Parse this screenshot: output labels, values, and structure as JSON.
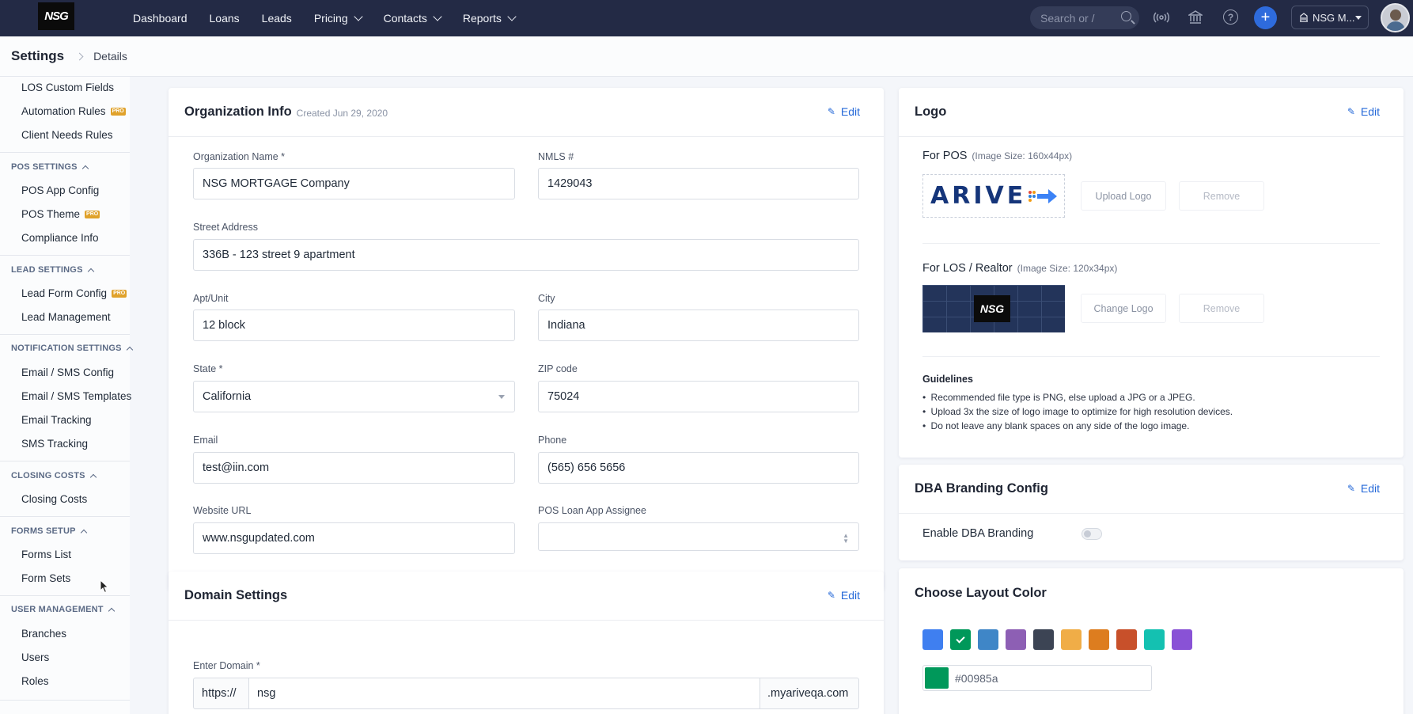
{
  "nav": {
    "logo_text": "NSG",
    "links": [
      {
        "label": "Dashboard",
        "has_menu": false
      },
      {
        "label": "Loans",
        "has_menu": false
      },
      {
        "label": "Leads",
        "has_menu": false
      },
      {
        "label": "Pricing",
        "has_menu": true
      },
      {
        "label": "Contacts",
        "has_menu": true
      },
      {
        "label": "Reports",
        "has_menu": true
      }
    ],
    "search_placeholder": "Search or /",
    "org_label": "NSG M...",
    "accent": "#2e6bdc",
    "bar_color": "#232a45"
  },
  "breadcrumb": {
    "title": "Settings",
    "current": "Details"
  },
  "sidebar": {
    "items": [
      {
        "label": "LOS Custom Fields",
        "pro": false
      },
      {
        "label": "Automation Rules",
        "pro": true
      },
      {
        "label": "Client Needs Rules",
        "pro": false
      }
    ],
    "sections": [
      {
        "title": "POS SETTINGS",
        "items": [
          {
            "label": "POS App Config",
            "pro": false
          },
          {
            "label": "POS Theme",
            "pro": true
          },
          {
            "label": "Compliance Info",
            "pro": false
          }
        ]
      },
      {
        "title": "LEAD SETTINGS",
        "items": [
          {
            "label": "Lead Form Config",
            "pro": true
          },
          {
            "label": "Lead Management",
            "pro": false
          }
        ]
      },
      {
        "title": "NOTIFICATION SETTINGS",
        "items": [
          {
            "label": "Email / SMS Config",
            "pro": false
          },
          {
            "label": "Email / SMS Templates",
            "pro": false
          },
          {
            "label": "Email Tracking",
            "pro": false
          },
          {
            "label": "SMS Tracking",
            "pro": false
          }
        ]
      },
      {
        "title": "CLOSING COSTS",
        "items": [
          {
            "label": "Closing Costs",
            "pro": false
          }
        ]
      },
      {
        "title": "FORMS SETUP",
        "items": [
          {
            "label": "Forms List",
            "pro": false
          },
          {
            "label": "Form Sets",
            "pro": false
          }
        ]
      },
      {
        "title": "USER MANAGEMENT",
        "items": [
          {
            "label": "Branches",
            "pro": false
          },
          {
            "label": "Users",
            "pro": false
          },
          {
            "label": "Roles",
            "pro": false
          }
        ]
      }
    ],
    "pro_badge": "PRO"
  },
  "org_info": {
    "title": "Organization Info",
    "created": "Created Jun 29, 2020",
    "edit_label": "Edit",
    "fields": {
      "org_name": {
        "label": "Organization Name *",
        "value": "NSG MORTGAGE Company"
      },
      "nmls": {
        "label": "NMLS #",
        "value": "1429043"
      },
      "street": {
        "label": "Street Address",
        "value": "336B - 123 street 9 apartment"
      },
      "apt": {
        "label": "Apt/Unit",
        "value": "12 block"
      },
      "city": {
        "label": "City",
        "value": "Indiana"
      },
      "state": {
        "label": "State *",
        "value": "California"
      },
      "zip": {
        "label": "ZIP code",
        "value": "75024"
      },
      "email": {
        "label": "Email",
        "value": "test@iin.com"
      },
      "phone": {
        "label": "Phone",
        "value": "(565) 656 5656"
      },
      "website": {
        "label": "Website URL",
        "value": "www.nsgupdated.com"
      },
      "assignee": {
        "label": "POS Loan App Assignee",
        "value": ""
      }
    }
  },
  "domain": {
    "title": "Domain Settings",
    "edit_label": "Edit",
    "label": "Enter Domain *",
    "prefix": "https://",
    "value": "nsg",
    "suffix": ".myariveqa.com"
  },
  "logo": {
    "title": "Logo",
    "edit_label": "Edit",
    "pos": {
      "label": "For POS",
      "size_hint": "(Image Size: 160x44px)",
      "image_text": "ARIVE",
      "upload_label": "Upload Logo",
      "remove_label": "Remove"
    },
    "los": {
      "label": "For LOS / Realtor",
      "size_hint": "(Image Size: 120x34px)",
      "image_text": "NSG",
      "change_label": "Change Logo",
      "remove_label": "Remove"
    },
    "guidelines_title": "Guidelines",
    "guidelines": [
      "Recommended file type is PNG, else upload a JPG or a JPEG.",
      "Upload 3x the size of logo image to optimize for high resolution devices.",
      "Do not leave any blank spaces on any side of the logo image."
    ]
  },
  "dba": {
    "title": "DBA Branding Config",
    "edit_label": "Edit",
    "toggle_label": "Enable DBA Branding",
    "enabled": false
  },
  "layout_color": {
    "title": "Choose Layout Color",
    "swatches": [
      "#3f7ff0",
      "#00985a",
      "#3f86c7",
      "#8d5fb4",
      "#3c4454",
      "#f0ad47",
      "#dd7d1f",
      "#c8502a",
      "#14c1b1",
      "#8952d6"
    ],
    "selected_index": 1,
    "hex_value": "#00985a"
  }
}
